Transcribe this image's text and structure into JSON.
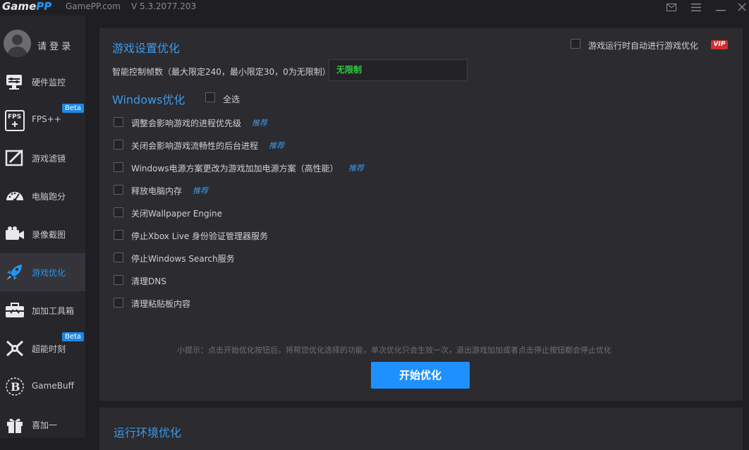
{
  "titlebar": {
    "logo_game": "Game",
    "logo_pp": "PP",
    "site": "GamePP.com",
    "version": "V 5.3.2077.203"
  },
  "sidebar": {
    "login_label": "请 登 录",
    "beta_label": "Beta",
    "items": [
      {
        "label": "硬件监控",
        "icon": "hardware-monitor-icon"
      },
      {
        "label": "FPS++",
        "icon": "fps-icon",
        "beta": true
      },
      {
        "label": "游戏滤镜",
        "icon": "game-filter-icon"
      },
      {
        "label": "电脑跑分",
        "icon": "benchmark-icon"
      },
      {
        "label": "录像截图",
        "icon": "video-capture-icon"
      },
      {
        "label": "游戏优化",
        "icon": "rocket-icon",
        "active": true
      },
      {
        "label": "加加工具箱",
        "icon": "toolbox-icon"
      },
      {
        "label": "超能时刻",
        "icon": "super-moment-icon",
        "beta": true
      },
      {
        "label": "GameBuff",
        "icon": "gamebuff-icon"
      },
      {
        "label": "喜加一",
        "icon": "gift-icon"
      }
    ]
  },
  "main": {
    "section_title": "游戏设置优化",
    "auto_optimize_label": "游戏运行时自动进行游戏优化",
    "vip_label": "VIP",
    "fps_limit_label": "智能控制帧数（最大限定240，最小限定30，0为无限制）",
    "fps_limit_value": "无限制",
    "windows_title": "Windows优化",
    "select_all_label": "全选",
    "recommend_label": "推荐",
    "options": [
      {
        "label": "调整会影响游戏的进程优先级",
        "recommended": true
      },
      {
        "label": "关闭会影响游戏流畅性的后台进程",
        "recommended": true
      },
      {
        "label": "Windows电源方案更改为游戏加加电源方案（高性能）",
        "recommended": true
      },
      {
        "label": "释放电脑内存",
        "recommended": true
      },
      {
        "label": "关闭Wallpaper Engine",
        "recommended": false
      },
      {
        "label": "停止Xbox Live 身份验证管理器服务",
        "recommended": false
      },
      {
        "label": "停止Windows Search服务",
        "recommended": false
      },
      {
        "label": "清理DNS",
        "recommended": false
      },
      {
        "label": "清理粘贴板内容",
        "recommended": false
      }
    ],
    "hint": "小提示：点击开始优化按钮后，将帮您优化选择的功能，单次优化只会生效一次，退出游戏加加或者点击停止按钮都会停止优化",
    "start_button": "开始优化",
    "section2_title": "运行环境优化"
  },
  "colors": {
    "accent": "#1e90ff",
    "title_blue": "#3d9be9",
    "green": "#2ecc40",
    "vip_red": "#d32f2f"
  }
}
